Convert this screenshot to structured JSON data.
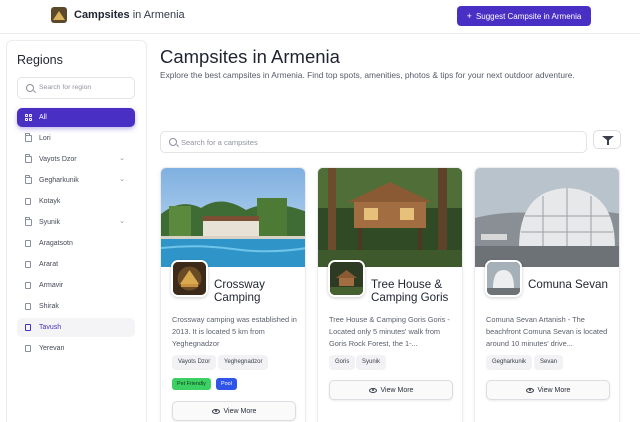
{
  "header": {
    "brand_bold": "Campsites",
    "brand_rest": "in Armenia",
    "suggest_label": "Suggest Campsite in Armenia",
    "accent_color": "#4a2fc4"
  },
  "sidebar": {
    "title": "Regions",
    "search_placeholder": "Search for region",
    "items": [
      {
        "label": "All",
        "icon": "grid-icon",
        "state": "selected"
      },
      {
        "label": "Lori",
        "icon": "folder-icon"
      },
      {
        "label": "Vayots Dzor",
        "icon": "folder-icon",
        "expandable": true
      },
      {
        "label": "Gegharkunik",
        "icon": "folder-icon",
        "expandable": true
      },
      {
        "label": "Kotayk",
        "icon": "file-icon"
      },
      {
        "label": "Syunik",
        "icon": "folder-icon",
        "expandable": true
      },
      {
        "label": "Aragatsotn",
        "icon": "file-icon"
      },
      {
        "label": "Ararat",
        "icon": "file-icon"
      },
      {
        "label": "Armavir",
        "icon": "file-icon"
      },
      {
        "label": "Shirak",
        "icon": "file-icon"
      },
      {
        "label": "Tavush",
        "icon": "file-icon",
        "state": "hover"
      },
      {
        "label": "Yerevan",
        "icon": "file-icon"
      }
    ]
  },
  "main": {
    "title": "Campsites in Armenia",
    "description": "Explore the best campsites in Armenia. Find top spots, amenities, photos & tips for your next outdoor adventure.",
    "search_placeholder": "Search for a campsites",
    "cards": [
      {
        "name": "Crossway Camping",
        "description": "Crossway camping was established in 2013. It is located 5 km from Yeghegnadzor",
        "tags": [
          "Vayots Dzor",
          "Yeghegnadzor"
        ],
        "pills": [
          "Pet Friendly",
          "Pool"
        ],
        "cta": "View More"
      },
      {
        "name": "Tree House & Camping Goris",
        "description": "Tree House & Camping Goris Goris - Located only 5 minutes' walk from Goris Rock Forest, the 1-...",
        "tags": [
          "Goris",
          "Syunik"
        ],
        "cta": "View More"
      },
      {
        "name": "Comuna Sevan",
        "description": "Comuna Sevan Artanish - The beachfront Comuna Sevan is located around 10 minutes' drive...",
        "tags": [
          "Gegharkunik",
          "Sevan"
        ],
        "cta": "View More"
      }
    ]
  }
}
